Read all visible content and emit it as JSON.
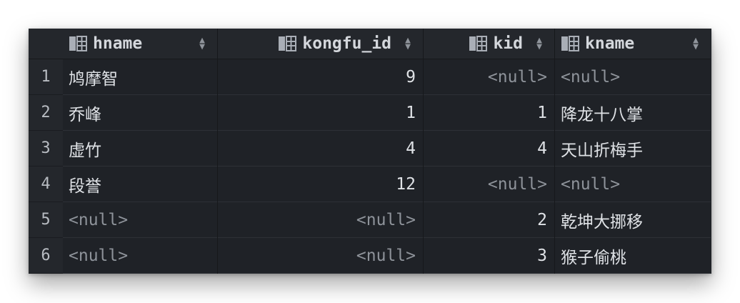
{
  "columns": [
    {
      "name": "hname",
      "icon": "table-column-icon",
      "sort": "sort-arrows-icon"
    },
    {
      "name": "kongfu_id",
      "icon": "table-column-icon",
      "sort": "sort-arrows-icon"
    },
    {
      "name": "kid",
      "icon": "table-column-icon",
      "sort": "sort-arrows-icon"
    },
    {
      "name": "kname",
      "icon": "table-column-icon",
      "sort": "sort-arrows-icon"
    }
  ],
  "rows": [
    {
      "num": "1",
      "hname": "鸠摩智",
      "kongfu_id": "9",
      "kid": "<null>",
      "kname": "<null>"
    },
    {
      "num": "2",
      "hname": "乔峰",
      "kongfu_id": "1",
      "kid": "1",
      "kname": "降龙十八掌"
    },
    {
      "num": "3",
      "hname": "虚竹",
      "kongfu_id": "4",
      "kid": "4",
      "kname": "天山折梅手"
    },
    {
      "num": "4",
      "hname": "段誉",
      "kongfu_id": "12",
      "kid": "<null>",
      "kname": "<null>"
    },
    {
      "num": "5",
      "hname": "<null>",
      "kongfu_id": "<null>",
      "kid": "2",
      "kname": "乾坤大挪移"
    },
    {
      "num": "6",
      "hname": "<null>",
      "kongfu_id": "<null>",
      "kid": "3",
      "kname": "猴子偷桃"
    }
  ],
  "colors": {
    "background": "#1f2227",
    "header": "#24272c",
    "text": "#dfe2e6",
    "null_text": "#8e939a"
  }
}
